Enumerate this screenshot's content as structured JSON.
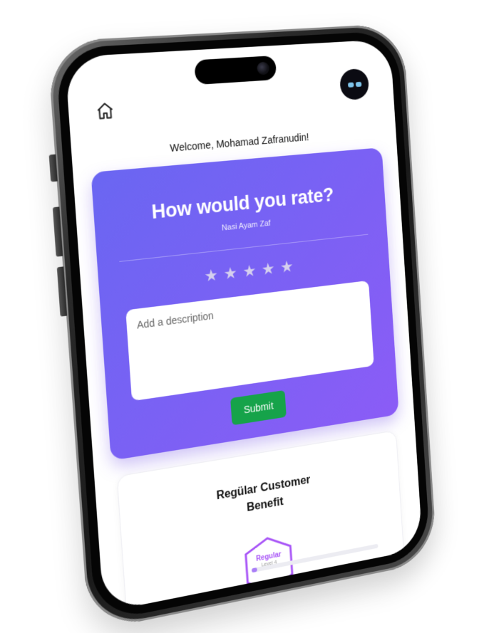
{
  "header": {
    "home_icon": "home-icon",
    "avatar_icon": "robot-avatar-icon"
  },
  "welcome": {
    "text": "Welcome, Mohamad Zafranudin!"
  },
  "rating_card": {
    "title": "How would you rate?",
    "item_name": "Nasi Ayam Zaf",
    "stars_total": 5,
    "stars_selected": 0,
    "star_glyph": "★",
    "description_placeholder": "Add a description",
    "submit_label": "Submit",
    "gradient_start": "#6a66f2",
    "gradient_end": "#8b5cf6",
    "submit_color": "#16a34a"
  },
  "benefit_card": {
    "title": "Regülar Customer Benefit",
    "badge_label": "Regular",
    "badge_level": "Level 4",
    "badge_stars": "★★",
    "badge_color": "#a855f7"
  }
}
